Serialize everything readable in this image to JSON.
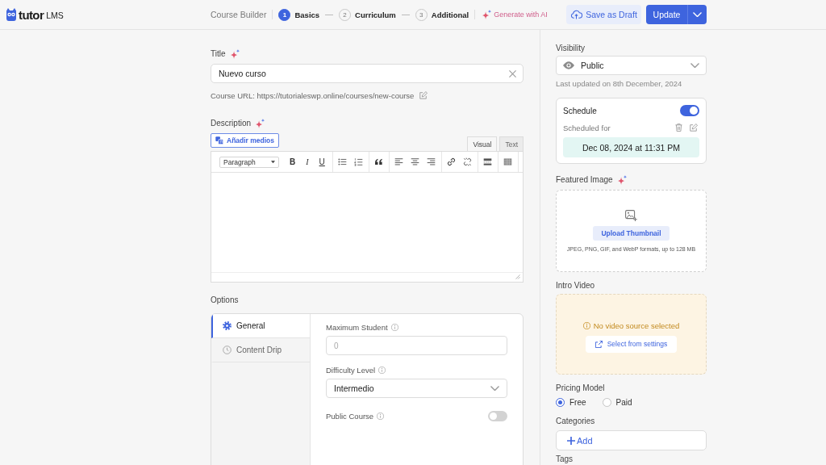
{
  "header": {
    "logo": {
      "name": "tutor",
      "suffix": "LMS"
    },
    "builder_label": "Course Builder",
    "steps": [
      {
        "number": "1",
        "label": "Basics",
        "selected": true
      },
      {
        "number": "2",
        "label": "Curriculum",
        "selected": false
      },
      {
        "number": "3",
        "label": "Additional",
        "selected": false
      }
    ],
    "ai_button": "Generate with AI",
    "draft_button": "Save as Draft",
    "update_button": "Update"
  },
  "main": {
    "title": {
      "label": "Title",
      "value": "Nuevo curso"
    },
    "course_url": "Course URL: https://tutorialeswp.online/courses/new-course",
    "description": {
      "label": "Description",
      "media_button": "Añadir medios",
      "editor_tabs": [
        {
          "label": "Visual",
          "selected": true
        },
        {
          "label": "Text",
          "selected": false
        }
      ],
      "toolbar": [
        {
          "items": [
            {
              "kind": "format",
              "label": "Paragraph"
            },
            {
              "kind": "bold",
              "label": "B"
            },
            {
              "kind": "italic",
              "label": "I"
            },
            {
              "kind": "underline",
              "label": "U"
            }
          ]
        },
        {
          "items": [
            {
              "kind": "bullet-list"
            },
            {
              "kind": "numbered-list"
            }
          ]
        },
        {
          "items": [
            {
              "kind": "quote"
            }
          ]
        },
        {
          "items": [
            {
              "kind": "align-left"
            },
            {
              "kind": "align-center"
            },
            {
              "kind": "align-right"
            }
          ]
        },
        {
          "items": [
            {
              "kind": "link"
            },
            {
              "kind": "unlink"
            }
          ]
        },
        {
          "items": [
            {
              "kind": "more"
            }
          ]
        },
        {
          "items": [
            {
              "kind": "toolbar-toggle"
            }
          ]
        }
      ]
    },
    "options": {
      "label": "Options",
      "tabs": [
        {
          "kind": "settings",
          "label": "General",
          "selected": true
        },
        {
          "kind": "schedule",
          "label": "Content Drip",
          "selected": false
        }
      ],
      "fields": [
        {
          "kind": "input",
          "label": "Maximum Student",
          "placeholder": "0"
        },
        {
          "kind": "select",
          "label": "Difficulty Level",
          "value": "Intermedio"
        },
        {
          "kind": "toggle",
          "label": "Public Course",
          "on": false
        }
      ]
    }
  },
  "sidebar": {
    "visibility": {
      "label": "Visibility",
      "value": "Public",
      "note": "Last updated on 8th December, 2024"
    },
    "schedule": {
      "label": "Schedule",
      "on": true,
      "sublabel": "Scheduled for",
      "datetime": "Dec 08, 2024 at 11:31 PM"
    },
    "featured_image": {
      "label": "Featured Image",
      "button": "Upload Thumbnail",
      "hint": "JPEG, PNG, GIF, and WebP formats, up to 128 MB"
    },
    "intro_video": {
      "label": "Intro Video",
      "message": "No video source selected",
      "button": "Select from settings"
    },
    "pricing": {
      "label": "Pricing Model",
      "options": [
        {
          "label": "Free",
          "selected": true
        },
        {
          "label": "Paid",
          "selected": false
        }
      ]
    },
    "categories": {
      "label": "Categories",
      "button": "Add"
    },
    "tags": {
      "label": "Tags"
    }
  }
}
